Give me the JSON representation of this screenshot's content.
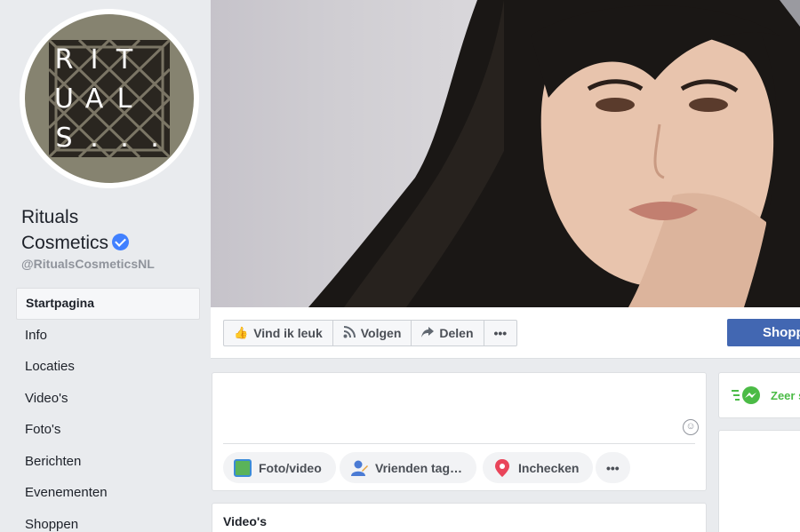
{
  "page": {
    "name_line1": "Rituals",
    "name_line2": "Cosmetics",
    "handle": "@RitualsCosmeticsNL",
    "logo_letters": [
      "R",
      "I",
      "T",
      "U",
      "A",
      "L",
      "S",
      ".",
      ".",
      "."
    ]
  },
  "nav": {
    "items": [
      {
        "label": "Startpagina",
        "active": true
      },
      {
        "label": "Info"
      },
      {
        "label": "Locaties"
      },
      {
        "label": "Video's"
      },
      {
        "label": "Foto's"
      },
      {
        "label": "Berichten"
      },
      {
        "label": "Evenementen"
      },
      {
        "label": "Shoppen"
      }
    ]
  },
  "actions": {
    "like": "Vind ik leuk",
    "follow": "Volgen",
    "share": "Delen",
    "more": "•••",
    "shop": "Shopp"
  },
  "composer": {
    "photo_video": "Foto/video",
    "tag_friends": "Vrienden tag…",
    "check_in": "Inchecken",
    "more": "•••"
  },
  "sections": {
    "videos_title": "Video's"
  },
  "right": {
    "messenger_text": "Zeer s"
  },
  "colors": {
    "accent": "#4267b2",
    "verified": "#4080ff",
    "messenger": "#4bbb46",
    "background": "#e9ebee"
  }
}
